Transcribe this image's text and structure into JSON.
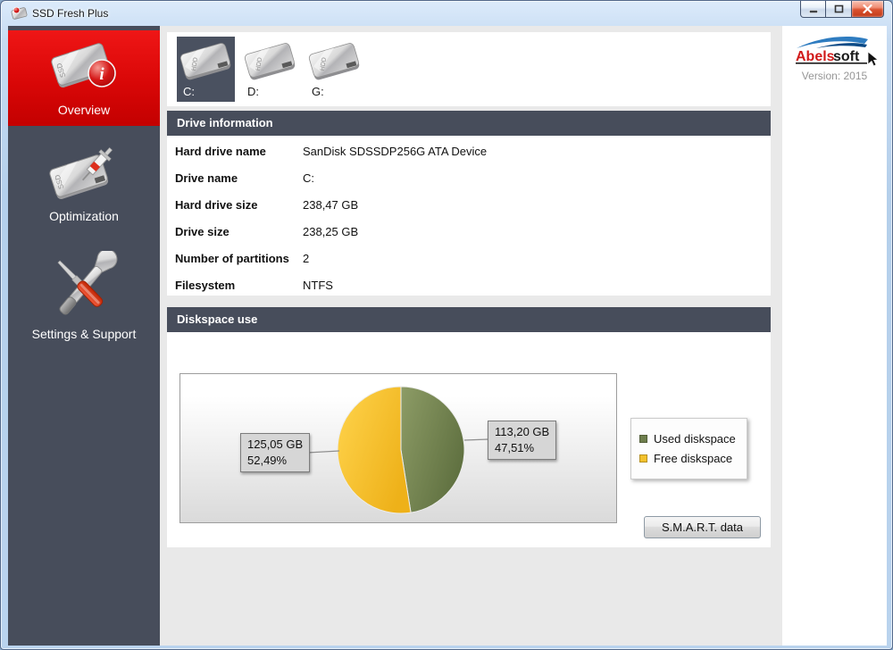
{
  "window": {
    "title": "SSD Fresh Plus"
  },
  "sidebar": {
    "icon_text": "SSD",
    "items": [
      {
        "label": "Overview",
        "active": true
      },
      {
        "label": "Optimization",
        "active": false
      },
      {
        "label": "Settings & Support",
        "active": false
      }
    ]
  },
  "drives": {
    "icon_text": "HDD",
    "items": [
      {
        "label": "C:",
        "selected": true
      },
      {
        "label": "D:",
        "selected": false
      },
      {
        "label": "G:",
        "selected": false
      }
    ]
  },
  "drive_info": {
    "header": "Drive information",
    "rows": [
      {
        "label": "Hard drive name",
        "value": "SanDisk SDSSDP256G ATA Device"
      },
      {
        "label": "Drive name",
        "value": "C:"
      },
      {
        "label": "Hard drive size",
        "value": "238,47 GB"
      },
      {
        "label": "Drive size",
        "value": "238,25 GB"
      },
      {
        "label": "Number of partitions",
        "value": "2"
      },
      {
        "label": "Filesystem",
        "value": "NTFS"
      }
    ]
  },
  "diskspace": {
    "header": "Diskspace use",
    "smart_button": "S.M.A.R.T. data"
  },
  "chart_data": {
    "type": "pie",
    "title": "Diskspace use",
    "start_angle_deg": 0,
    "direction": "clockwise",
    "legend_position": "right",
    "slices": [
      {
        "name": "Used diskspace",
        "value_gb": 113.2,
        "percent": 47.51,
        "label_lines": [
          "113,20 GB",
          "47,51%"
        ],
        "color": "#5f7040",
        "color_light": "#8d9c66",
        "swatch": "#6e7e4d"
      },
      {
        "name": "Free diskspace",
        "value_gb": 125.05,
        "percent": 52.49,
        "label_lines": [
          "125,05 GB",
          "52,49%"
        ],
        "color": "#eeb119",
        "color_light": "#ffd44d",
        "swatch": "#f2c12c"
      }
    ]
  },
  "branding": {
    "logo_part1": "Abels",
    "logo_part2": "soft",
    "version": "Version: 2015"
  },
  "colors": {
    "accent_red": "#d90707",
    "sidebar_bg": "#474d5b",
    "section_header_bg": "#474d5b",
    "used_green": "#6e7e4d",
    "free_yellow": "#f2c12c"
  }
}
